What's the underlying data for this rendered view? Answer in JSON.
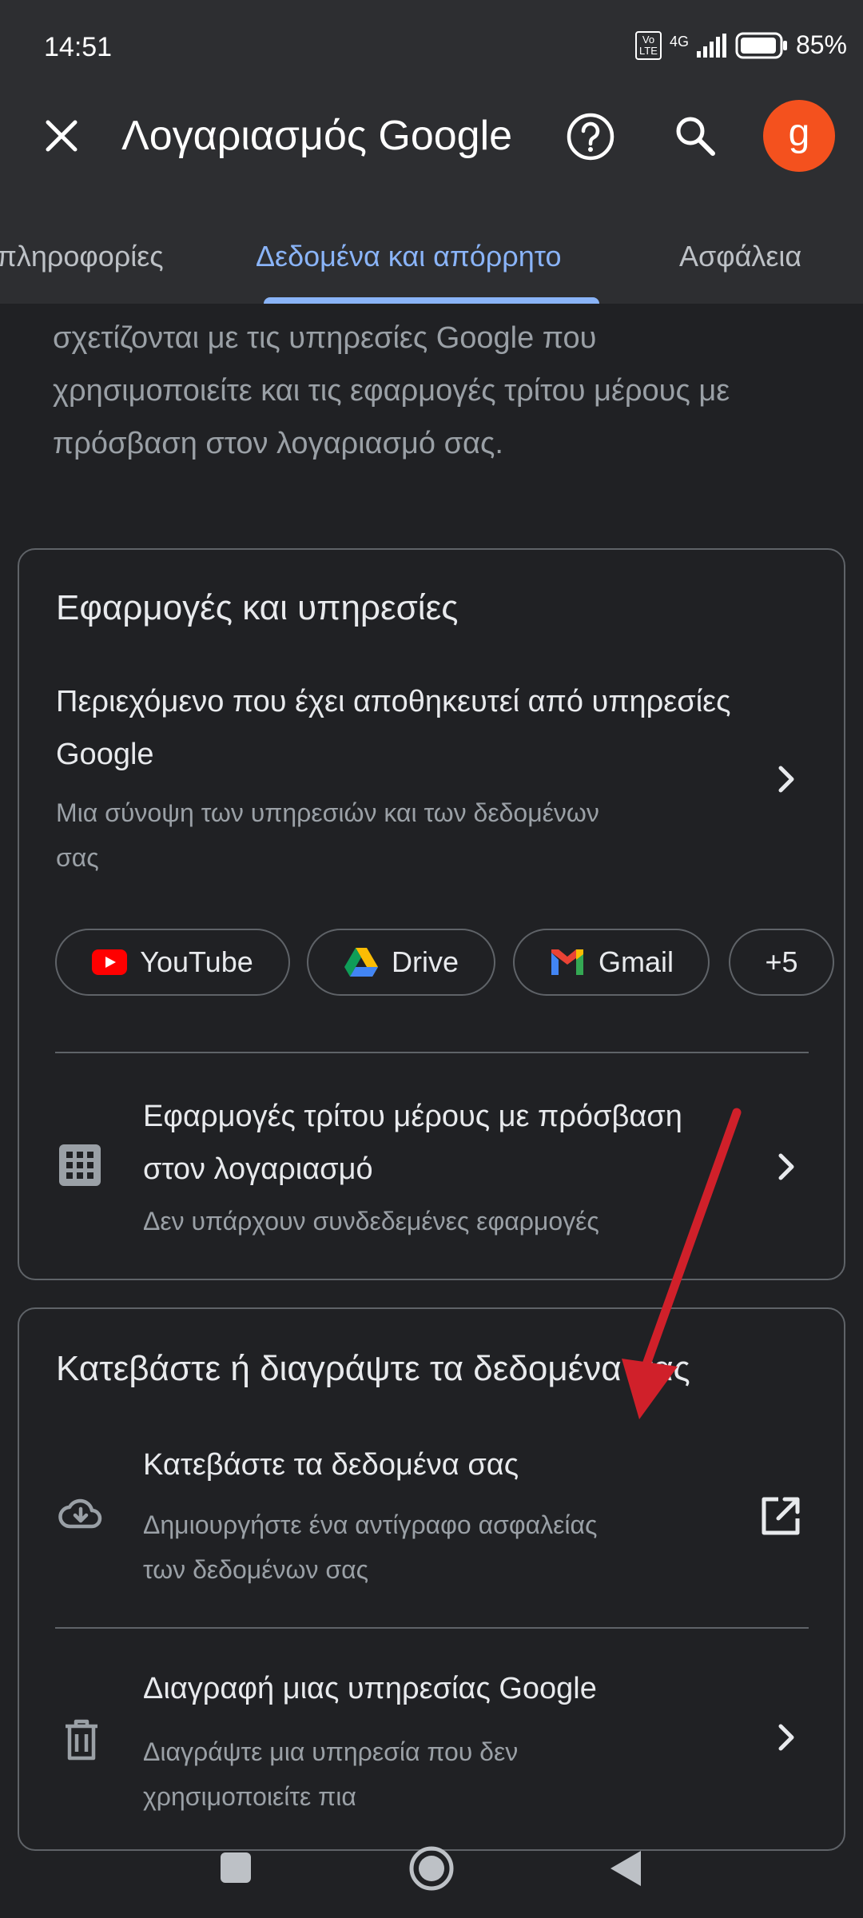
{
  "status_bar": {
    "time": "14:51",
    "network": "4G",
    "volte": "Vo\nLTE",
    "battery": "85%"
  },
  "app_bar": {
    "title": "Λογαριασμός Google",
    "avatar_letter": "g",
    "icons": [
      "close-icon",
      "help-icon",
      "search-icon"
    ]
  },
  "tabs": [
    {
      "label": "πληροφορίες",
      "active": false
    },
    {
      "label": "Δεδομένα και απόρρητο",
      "active": true
    },
    {
      "label": "Ασφάλεια",
      "active": false
    }
  ],
  "intro_text": "σχετίζονται με τις υπηρεσίες Google που χρησιμοποιείτε και τις εφαρμογές τρίτου μέρους με πρόσβαση στον λογαριασμό σας.",
  "apps_card": {
    "title": "Εφαρμογές και υπηρεσίες",
    "content_item": {
      "title": "Περιεχόμενο που έχει αποθηκευτεί από υπηρεσίες Google",
      "subtitle": "Μια σύνοψη των υπηρεσιών και των δεδομένων σας"
    },
    "chips": [
      {
        "label": "YouTube",
        "icon": "youtube-icon"
      },
      {
        "label": "Drive",
        "icon": "drive-icon"
      },
      {
        "label": "Gmail",
        "icon": "gmail-icon"
      },
      {
        "label": "+5",
        "icon": ""
      }
    ],
    "third_party_item": {
      "title": "Εφαρμογές τρίτου μέρους με πρόσβαση στον λογαριασμό",
      "subtitle": "Δεν υπάρχουν συνδεδεμένες εφαρμογές"
    }
  },
  "download_card": {
    "title": "Κατεβάστε ή διαγράψτε τα δεδομένα σας",
    "download_item": {
      "title": "Κατεβάστε τα δεδομένα σας",
      "subtitle": "Δημιουργήστε ένα αντίγραφο ασφαλείας των δεδομένων σας"
    },
    "delete_item": {
      "title": "Διαγραφή μιας υπηρεσίας Google",
      "subtitle": "Διαγράψτε μια υπηρεσία που δεν χρησιμοποιείτε πια"
    }
  },
  "colors": {
    "background": "#202124",
    "app_bar": "#2d2e31",
    "accent": "#8ab4f8",
    "avatar": "#f4511e",
    "annotation_arrow": "#d0202a"
  }
}
